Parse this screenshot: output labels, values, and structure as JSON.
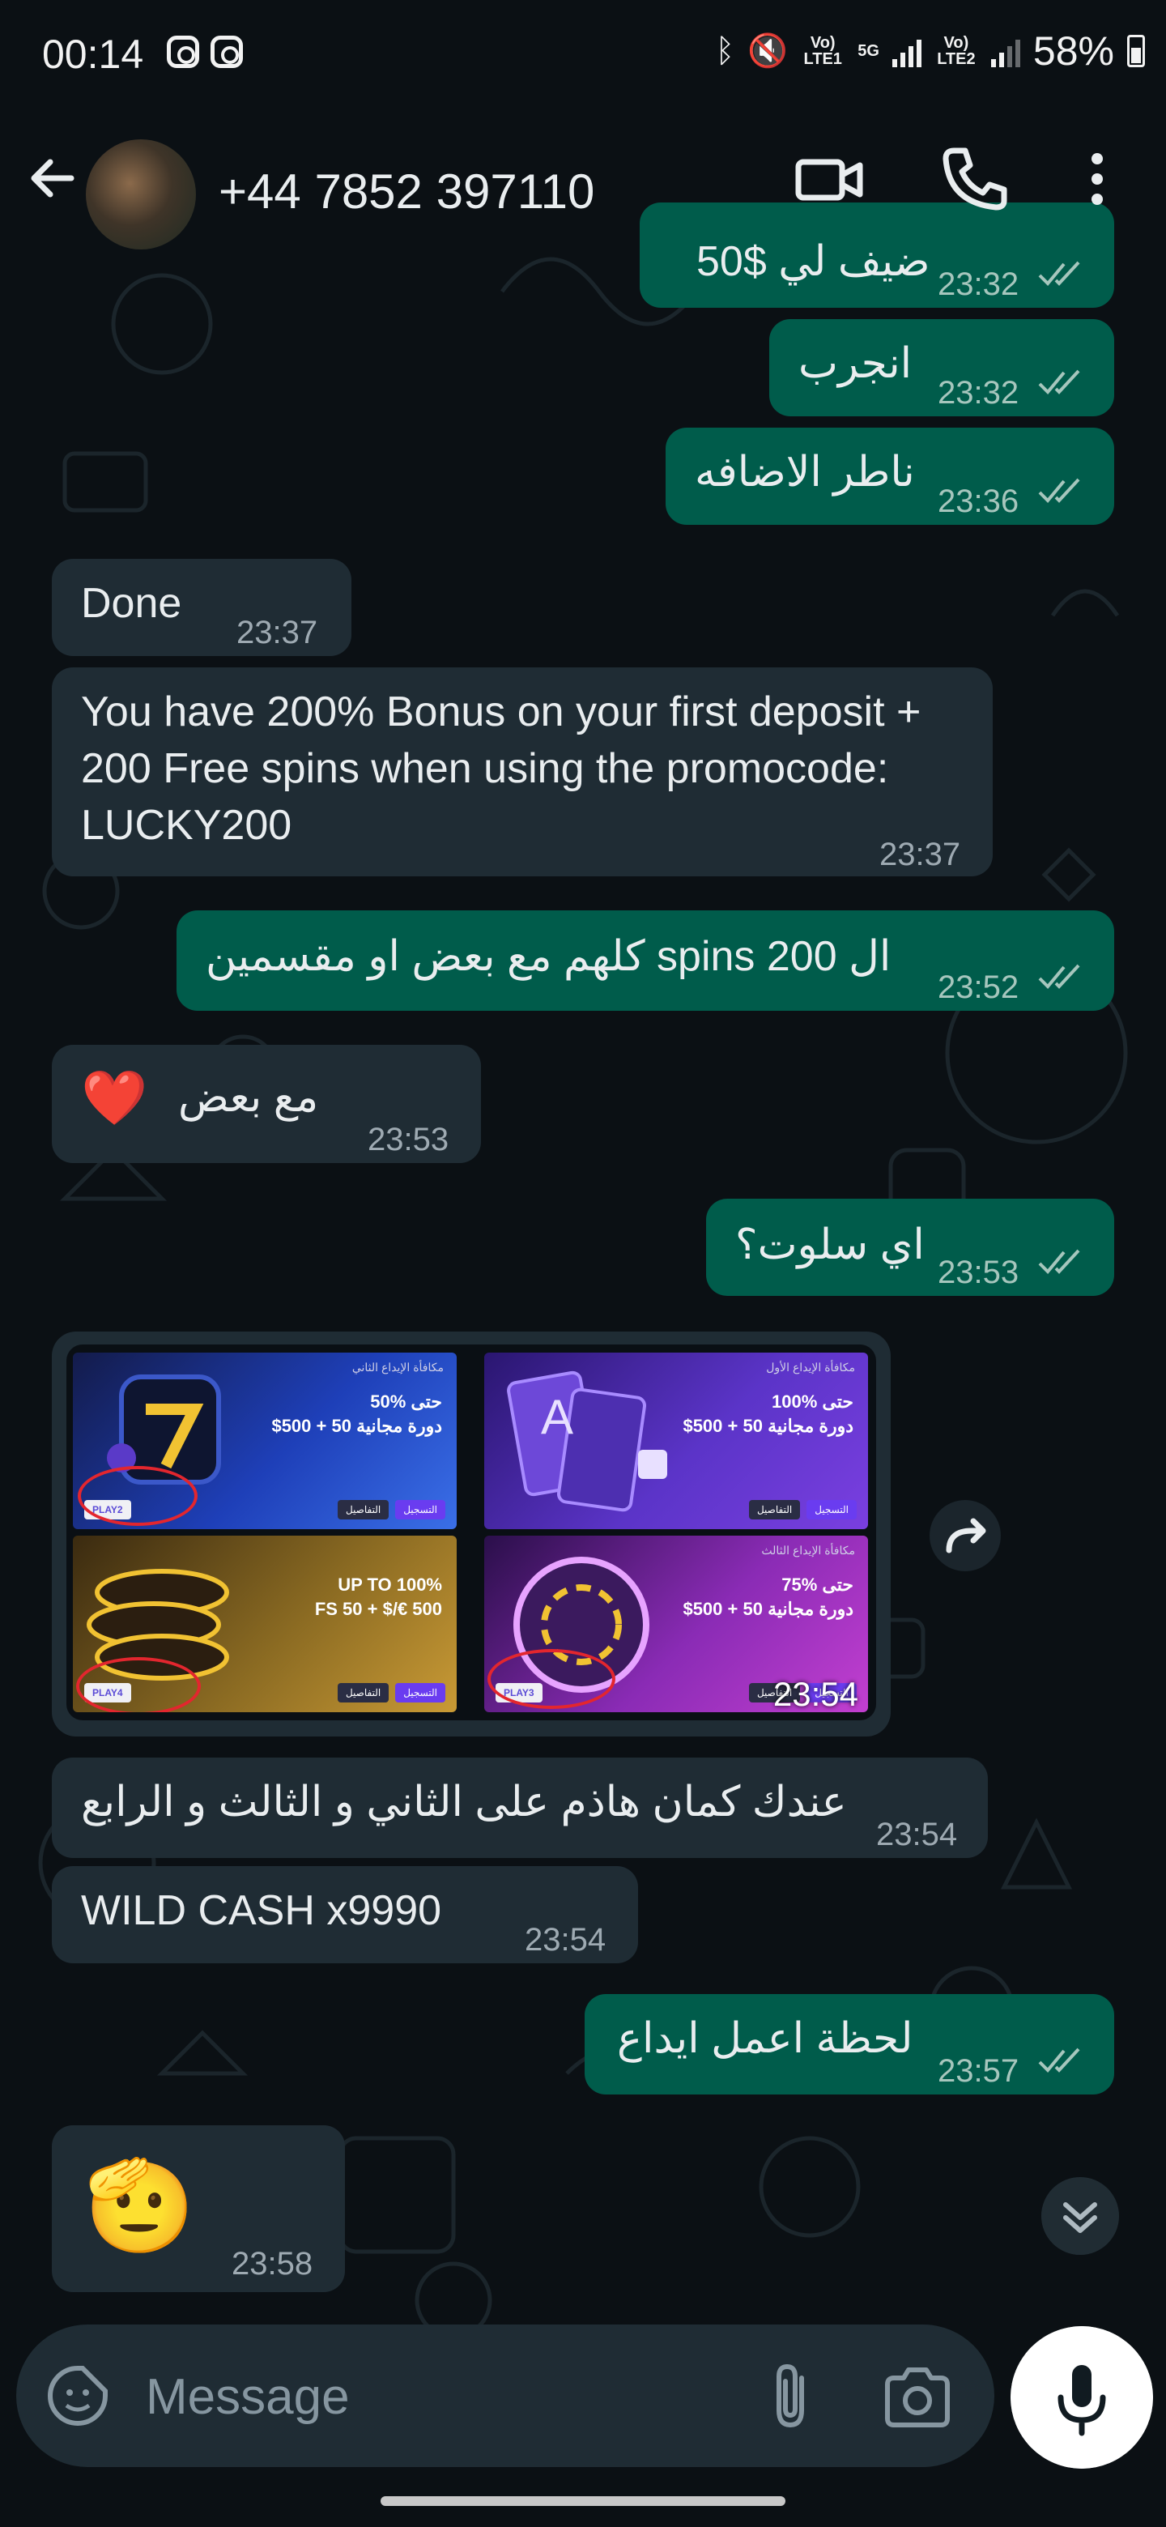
{
  "status_bar": {
    "time": "00:14",
    "lte1": "Vo) LTE1",
    "net": "5G",
    "lte2": "Vo) LTE2",
    "battery": "58%"
  },
  "header": {
    "contact": "+44 7852 397110",
    "icons": [
      "back-arrow-icon",
      "video-call-icon",
      "phone-icon",
      "more-vert-icon"
    ]
  },
  "messages": [
    {
      "dir": "out",
      "text": "ضيف لي $50",
      "time": "23:32"
    },
    {
      "dir": "out",
      "text": "انجرب",
      "time": "23:32"
    },
    {
      "dir": "out",
      "text": "ناطر الاضافه",
      "time": "23:36"
    },
    {
      "dir": "in",
      "text": "Done",
      "time": "23:37"
    },
    {
      "dir": "in",
      "text": "You have 200% Bonus on your first deposit + 200 Free spins when using the promocode: LUCKY200",
      "time": "23:37"
    },
    {
      "dir": "out",
      "text": "ال 200 spins كلهم مع بعض او مقسمين",
      "time": "23:52"
    },
    {
      "dir": "in",
      "text": "مع بعض",
      "emoji": "❤️",
      "time": "23:53"
    },
    {
      "dir": "out",
      "text": "اي سلوت؟",
      "time": "23:53"
    },
    {
      "dir": "in",
      "type": "image",
      "time": "23:54"
    },
    {
      "dir": "in",
      "text": "عندك كمان هاذم على الثاني و الثالث و الرابع",
      "time": "23:54"
    },
    {
      "dir": "in",
      "text": "WILD CASH x9990",
      "time": "23:54"
    },
    {
      "dir": "out",
      "text": "لحظة اعمل ايداع",
      "time": "23:57"
    },
    {
      "dir": "in",
      "emoji": "🫡",
      "time": "23:58"
    }
  ],
  "image_tiles": [
    {
      "top": "مكافأة الإيداع الثاني",
      "line1": "50% حتى",
      "line2": "$500 + 50 دورة مجانية",
      "code": "PLAY2",
      "btn1": "التسجيل",
      "btn2": "التفاصيل",
      "bg": "#2f5ad6"
    },
    {
      "top": "مكافأة الإيداع الأول",
      "line1": "100% حتى",
      "line2": "$500 + 50 دورة مجانية",
      "code": "",
      "btn1": "التسجيل",
      "btn2": "التفاصيل",
      "bg": "#5b34c8"
    },
    {
      "top": "",
      "line1": "UP TO 100%",
      "line2": "FS 50 + $/€ 500",
      "code": "PLAY4",
      "btn1": "التسجيل",
      "btn2": "التفاصيل",
      "bg": "#b08a2a"
    },
    {
      "top": "مكافأة الإيداع الثالث",
      "line1": "75% حتى",
      "line2": "$500 + 50 دورة مجانية",
      "code": "PLAY3",
      "btn1": "التسجيل",
      "btn2": "التفاصيل",
      "bg": "#9b2fbf"
    }
  ],
  "composer": {
    "placeholder": "Message"
  },
  "colors": {
    "background": "#0b1014",
    "incoming": "#1f2c34",
    "outgoing": "#005c4b",
    "read_ticks": "#a6c6bd"
  }
}
